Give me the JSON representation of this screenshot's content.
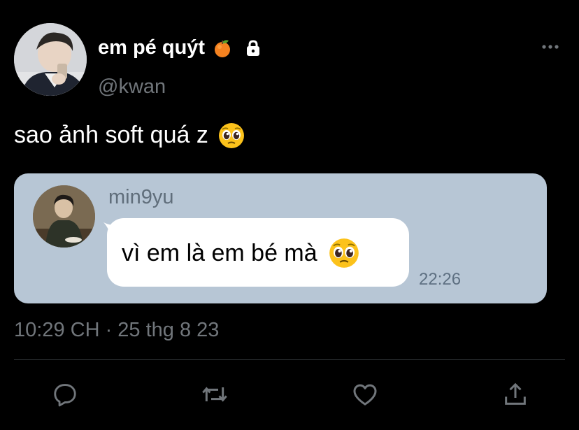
{
  "author": {
    "display_name": "em pé quýt",
    "handle": "@kwan",
    "name_badges": [
      "orange-emoji",
      "lock-icon"
    ]
  },
  "tweet": {
    "text": "sao ảnh soft quá z",
    "text_emoji": "pleading-face-emoji",
    "timestamp": "10:29 CH · 25 thg 8 23"
  },
  "attached_image": {
    "sender_name": "min9yu",
    "message": "vì em là em bé mà",
    "message_emoji": "pleading-face-emoji",
    "time": "22:26"
  },
  "actions": [
    "reply-icon",
    "retweet-icon",
    "like-icon",
    "share-icon"
  ],
  "colors": {
    "background": "#000000",
    "primary_text": "#ffffff",
    "secondary_text": "#71767b",
    "divider": "#2f3336",
    "media_background": "#b7c6d5",
    "bubble": "#ffffff",
    "icon": "#71767b"
  }
}
